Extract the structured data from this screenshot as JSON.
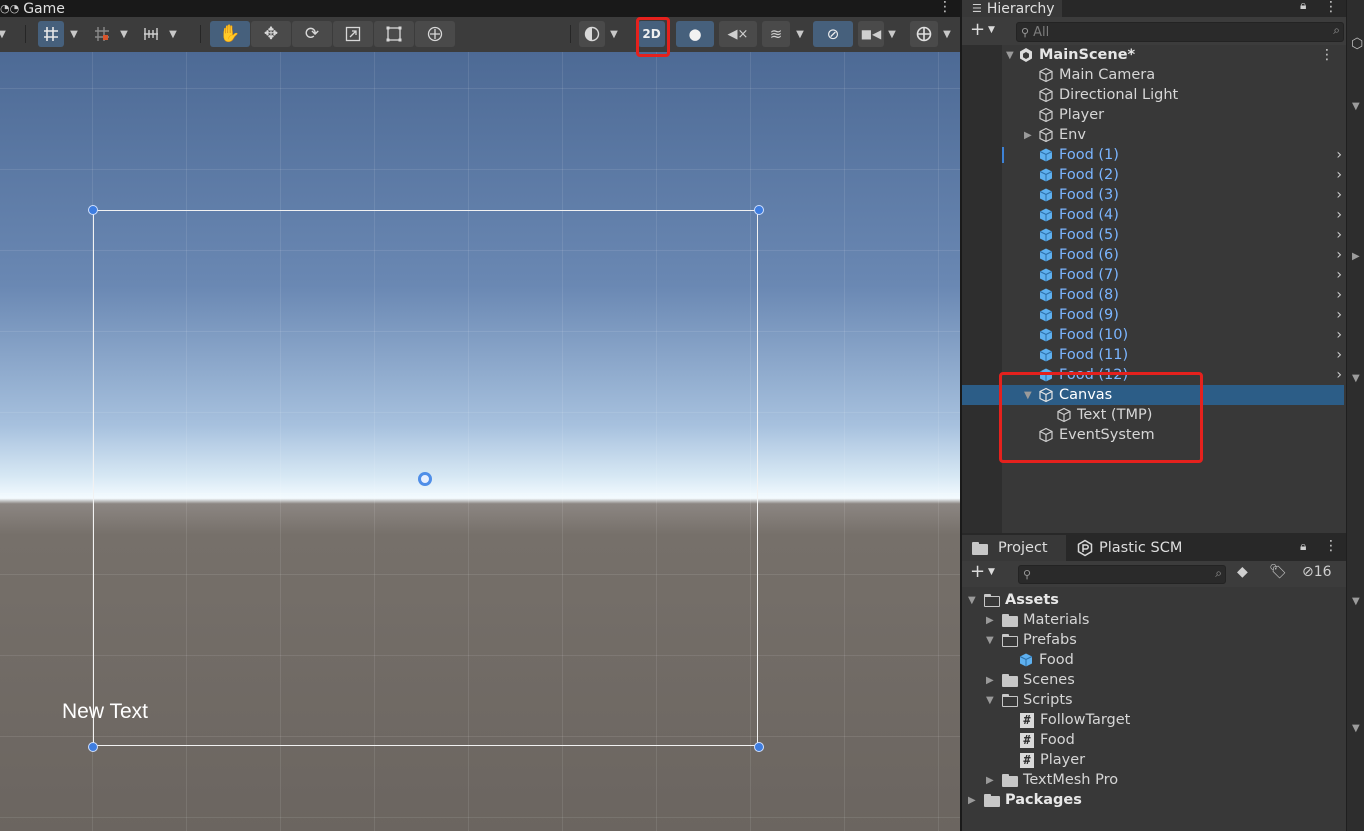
{
  "scene_view": {
    "tab_label": "Game",
    "toggle_2d_label": "2D",
    "canvas_text": "New Text"
  },
  "hierarchy": {
    "tab_label": "Hierarchy",
    "search_placeholder": "All",
    "scene_name": "MainScene*",
    "items": [
      {
        "label": "Main Camera"
      },
      {
        "label": "Directional Light"
      },
      {
        "label": "Player"
      },
      {
        "label": "Env"
      },
      {
        "label": "Food (1)"
      },
      {
        "label": "Food (2)"
      },
      {
        "label": "Food (3)"
      },
      {
        "label": "Food (4)"
      },
      {
        "label": "Food (5)"
      },
      {
        "label": "Food (6)"
      },
      {
        "label": "Food (7)"
      },
      {
        "label": "Food (8)"
      },
      {
        "label": "Food (9)"
      },
      {
        "label": "Food (10)"
      },
      {
        "label": "Food (11)"
      },
      {
        "label": "Food (12)"
      },
      {
        "label": "Canvas"
      },
      {
        "label": "Text (TMP)"
      },
      {
        "label": "EventSystem"
      }
    ]
  },
  "project": {
    "tab_label": "Project",
    "plastic_tab_label": "Plastic SCM",
    "hidden_count": "16",
    "tree": [
      {
        "label": "Assets"
      },
      {
        "label": "Materials"
      },
      {
        "label": "Prefabs"
      },
      {
        "label": "Food"
      },
      {
        "label": "Scenes"
      },
      {
        "label": "Scripts"
      },
      {
        "label": "FollowTarget"
      },
      {
        "label": "Food"
      },
      {
        "label": "Player"
      },
      {
        "label": "TextMesh Pro"
      },
      {
        "label": "Packages"
      }
    ]
  },
  "colors": {
    "selection": "#2c5d87",
    "prefab_text": "#7bb5ff",
    "highlight_box": "#e5211d",
    "handle": "#3e7de0"
  }
}
